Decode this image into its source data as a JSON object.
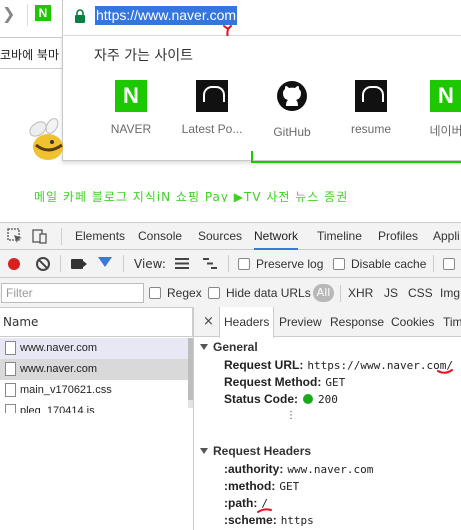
{
  "browser": {
    "tab_naver_letter": "N",
    "bookmark_strip_text": "코바에 북마",
    "url": "https://www.naver.com",
    "suggest_title": "자주 가는 사이트",
    "tiles": [
      {
        "label": "NAVER",
        "icon": "naver-logo-icon"
      },
      {
        "label": "Latest Po...",
        "icon": "latest-posts-logo-icon"
      },
      {
        "label": "GitHub",
        "icon": "github-logo-icon"
      },
      {
        "label": "resume",
        "icon": "resume-logo-icon"
      },
      {
        "label": "네이버",
        "icon": "naver-logo-icon"
      }
    ],
    "naver_letter": "N",
    "accent_color": "#1ec800",
    "annotation_color": "#e8101e"
  },
  "page_behind": {
    "links_text": "메일 카페 블로그 지식iN 쇼핑 Pay ▶TV 사전 뉴스 증권"
  },
  "devtools": {
    "tabs": [
      "Elements",
      "Console",
      "Sources",
      "Network",
      "Timeline",
      "Profiles",
      "Appli"
    ],
    "active_tab": "Network",
    "toolbar": {
      "view_label": "View:",
      "preserve_log": "Preserve log",
      "disable_cache": "Disable cache"
    },
    "filter": {
      "placeholder": "Filter",
      "regex": "Regex",
      "hide_data_urls": "Hide data URLs",
      "all": "All",
      "types": [
        "XHR",
        "JS",
        "CSS",
        "Img"
      ]
    },
    "requests": {
      "header": "Name",
      "rows": [
        "www.naver.com",
        "www.naver.com",
        "main_v170621.css",
        "pleg_170414.js"
      ]
    },
    "detail": {
      "close": "×",
      "tabs": [
        "Headers",
        "Preview",
        "Response",
        "Cookies",
        "Tim"
      ],
      "active_tab": "Headers",
      "general": {
        "title": "General",
        "request_url_key": "Request URL:",
        "request_url_val": "https://www.naver.com/",
        "method_key": "Request Method:",
        "method_val": "GET",
        "status_key": "Status Code:",
        "status_val": "200"
      },
      "request_headers": {
        "title": "Request Headers",
        "rows": [
          {
            "k": ":authority:",
            "v": "www.naver.com"
          },
          {
            "k": ":method:",
            "v": "GET"
          },
          {
            "k": ":path:",
            "v": "/"
          },
          {
            "k": ":scheme:",
            "v": "https"
          }
        ]
      },
      "ellipsis": "⋮"
    }
  }
}
